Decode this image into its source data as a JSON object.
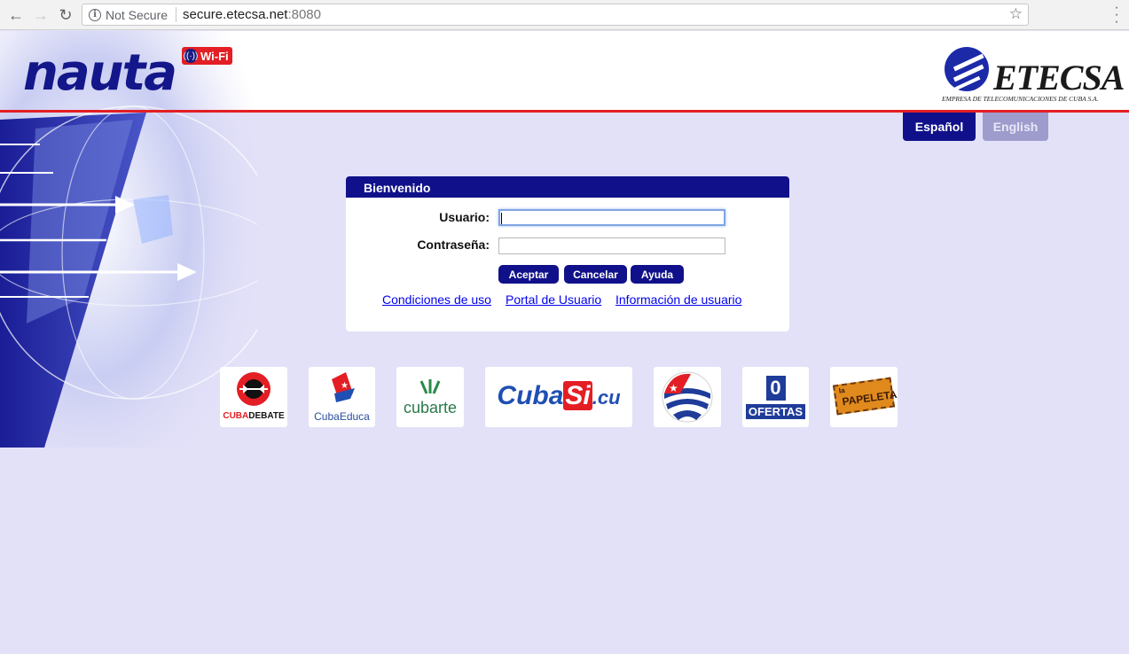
{
  "browser": {
    "security_label": "Not Secure",
    "url_host": "secure.etecsa.net",
    "url_port": ":8080"
  },
  "header": {
    "nauta_logo": "nauta",
    "wifi_badge": "Wi-Fi",
    "etecsa_logo": "ETECSA",
    "etecsa_tagline": "EMPRESA DE TELECOMUNICACIONES DE CUBA S.A."
  },
  "language": {
    "spanish": "Español",
    "english": "English"
  },
  "login": {
    "title": "Bienvenido",
    "username_label": "Usuario:",
    "username_value": "",
    "password_label": "Contraseña:",
    "password_value": "",
    "accept": "Aceptar",
    "cancel": "Cancelar",
    "help": "Ayuda",
    "links": {
      "terms": "Condiciones de uso",
      "portal": "Portal de Usuario",
      "info": "Información de usuario"
    }
  },
  "tiles": {
    "cubadebate_cuba": "CUBA",
    "cubadebate_debate": "DEBATE",
    "cubaeduca": "CubaEduca",
    "cubarte": "cubarte",
    "cubasi_cuba": "Cuba",
    "cubasi_si": "Si",
    "cubasi_cu": ".cu",
    "ofertas_zero": "0",
    "ofertas": "OFERTAS",
    "papeleta_la": "la",
    "papeleta": "PAPELETA"
  },
  "colors": {
    "navy": "#10118a",
    "red": "#e31e24",
    "page_bg": "#e3e1f8"
  }
}
